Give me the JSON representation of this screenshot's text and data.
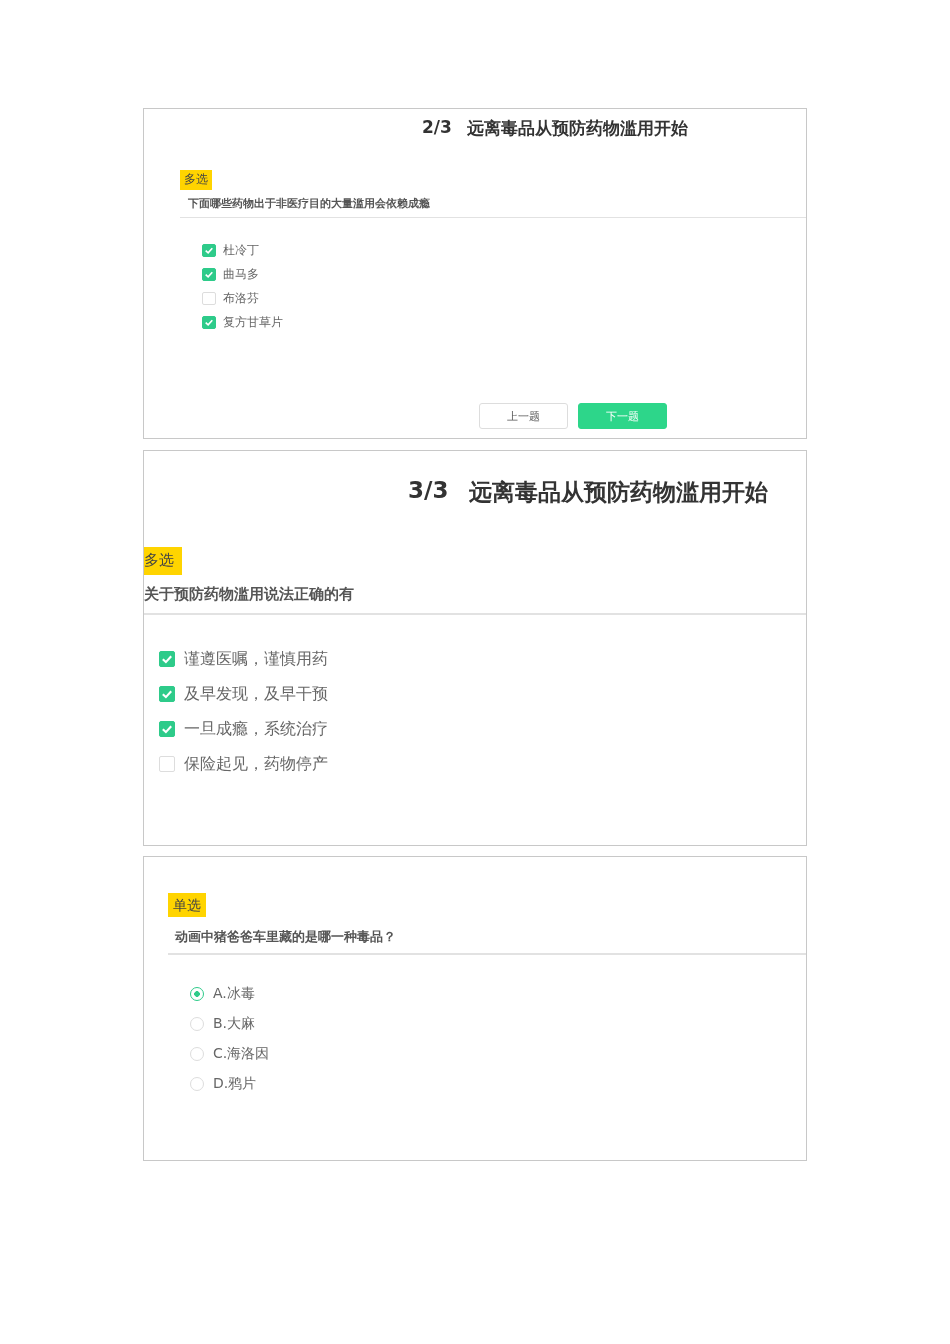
{
  "panels": [
    {
      "kind": "multiple",
      "progress": "2/3",
      "title": "远离毒品从预防药物滥用开始",
      "tag": "多选",
      "question": "下面哪些药物出于非医疗目的大量滥用会依赖成瘾",
      "options": [
        {
          "label": "杜冷丁",
          "checked": true
        },
        {
          "label": "曲马多",
          "checked": true
        },
        {
          "label": "布洛芬",
          "checked": false
        },
        {
          "label": "复方甘草片",
          "checked": true
        }
      ],
      "buttons": [
        {
          "label": "上一题",
          "primary": false
        },
        {
          "label": "下一题",
          "primary": true
        }
      ]
    },
    {
      "kind": "multiple",
      "progress": "3/3",
      "title": "远离毒品从预防药物滥用开始",
      "tag": "多选",
      "question": "关于预防药物滥用说法正确的有",
      "options": [
        {
          "label": "谨遵医嘱，谨慎用药",
          "checked": true
        },
        {
          "label": "及早发现，及早干预",
          "checked": true
        },
        {
          "label": "一旦成瘾，系统治疗",
          "checked": true
        },
        {
          "label": "保险起见，药物停产",
          "checked": false
        }
      ]
    },
    {
      "kind": "single",
      "tag": "单选",
      "question": "动画中猪爸爸车里藏的是哪一种毒品？",
      "options": [
        {
          "label": "A.冰毒",
          "selected": true
        },
        {
          "label": "B.大麻",
          "selected": false
        },
        {
          "label": "C.海洛因",
          "selected": false
        },
        {
          "label": "D.鸦片",
          "selected": false
        }
      ]
    }
  ]
}
